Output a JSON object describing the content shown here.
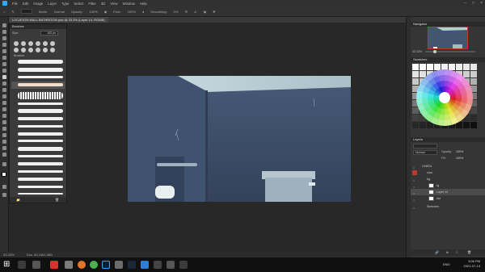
{
  "menubar": {
    "items": [
      "File",
      "Edit",
      "Image",
      "Layer",
      "Type",
      "Select",
      "Filter",
      "3D",
      "View",
      "Window",
      "Help"
    ]
  },
  "options_bar": {
    "mode_label": "Mode:",
    "mode_value": "Normal",
    "opacity_label": "Opacity:",
    "opacity_value": "100%",
    "flow_label": "Flow:",
    "flow_value": "100%",
    "smoothing_label": "Smoothing:",
    "smoothing_value": "0%"
  },
  "document": {
    "tab_title": "LOCATION WALL BATHROOM.psd @ 33.3% (Layer 14, RGB/8)"
  },
  "brushes_panel": {
    "title": "Brushes",
    "size_label": "Size:",
    "size_value": "102 px",
    "group_name": "Brushes"
  },
  "navigator": {
    "title": "Navigator",
    "zoom": "33.33%"
  },
  "swatches": {
    "title": "Swatches"
  },
  "layers_panel": {
    "title": "Layers",
    "blend_mode": "Normal",
    "opacity_label": "Opacity:",
    "opacity_value": "100%",
    "fill_label": "Fill:",
    "fill_value": "100%",
    "layers": [
      {
        "name": "LINEZ4",
        "kind": "group"
      },
      {
        "name": "char",
        "kind": "group"
      },
      {
        "name": "bg",
        "kind": "group"
      },
      {
        "name": "fg",
        "kind": "layer"
      },
      {
        "name": "Layer 14",
        "kind": "layer",
        "selected": true
      },
      {
        "name": "bkt",
        "kind": "layer"
      },
      {
        "name": "Sketches",
        "kind": "group"
      }
    ]
  },
  "statusbar": {
    "zoom": "33.33%",
    "doc_info": "Doc: 40.1M/1.36G"
  },
  "taskbar": {
    "lang": "ENG",
    "time": "3:06 PM",
    "date": "2021-07-13"
  },
  "colors": {
    "accent": "#31a8ff",
    "wall": "#435571",
    "ceiling": "#b9ccd3"
  }
}
